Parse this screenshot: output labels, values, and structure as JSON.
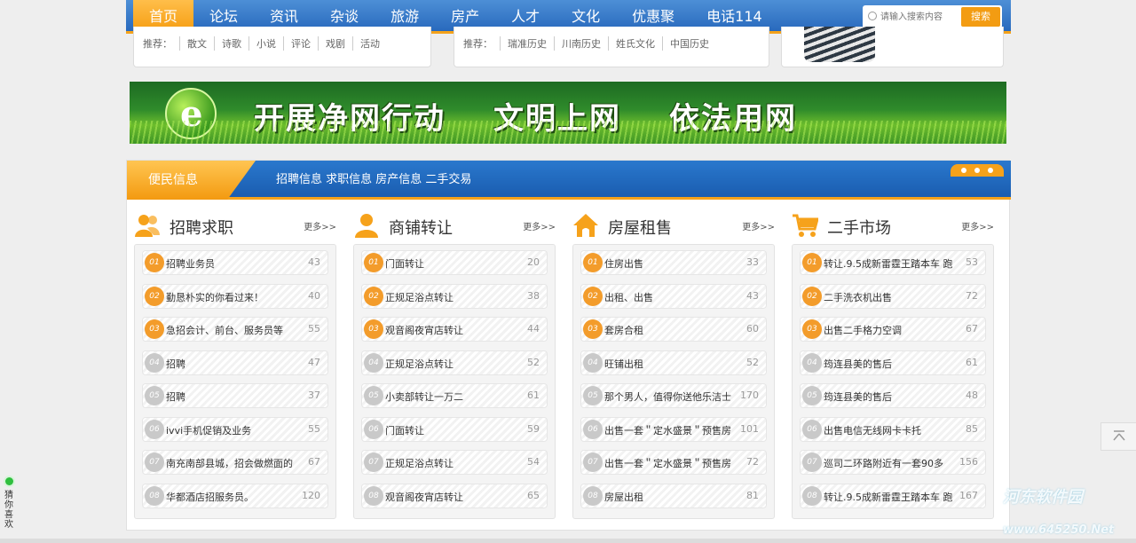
{
  "nav": {
    "items": [
      "首页",
      "论坛",
      "资讯",
      "杂谈",
      "旅游",
      "房产",
      "人才",
      "文化",
      "优惠聚",
      "电话114"
    ],
    "search_placeholder": "请输入搜索内容",
    "search_button": "搜索"
  },
  "top_boxes": [
    {
      "label": "推荐：",
      "tags": [
        "散文",
        "诗歌",
        "小说",
        "评论",
        "戏剧",
        "活动"
      ]
    },
    {
      "label": "推荐：",
      "tags": [
        "瑞准历史",
        "川南历史",
        "姓氏文化",
        "中国历史"
      ]
    }
  ],
  "banner": {
    "parts": [
      "开展净网行动",
      "文明上网",
      "依法用网"
    ]
  },
  "panel": {
    "tab": "便民信息",
    "links": "招聘信息 求职信息 房产信息 二手交易"
  },
  "columns": [
    {
      "title": "招聘求职",
      "more": "更多>>",
      "icon": "people-icon",
      "items": [
        {
          "num": "01",
          "text": "招聘业务员",
          "count": "43"
        },
        {
          "num": "02",
          "text": "勤恳朴实的你看过来！",
          "count": "40"
        },
        {
          "num": "03",
          "text": "急招会计、前台、服务员等",
          "count": "55"
        },
        {
          "num": "04",
          "text": "招聘",
          "count": "47"
        },
        {
          "num": "05",
          "text": "招聘",
          "count": "37"
        },
        {
          "num": "06",
          "text": "ivvi手机促销及业务",
          "count": "55"
        },
        {
          "num": "07",
          "text": "南充南部县城，招会做燃面的",
          "count": "67"
        },
        {
          "num": "08",
          "text": "华都酒店招服务员。",
          "count": "120"
        }
      ]
    },
    {
      "title": "商铺转让",
      "more": "更多>>",
      "icon": "person-icon",
      "items": [
        {
          "num": "01",
          "text": "门面转让",
          "count": "20"
        },
        {
          "num": "02",
          "text": "正规足浴点转让",
          "count": "38"
        },
        {
          "num": "03",
          "text": "观音阁夜宵店转让",
          "count": "44"
        },
        {
          "num": "04",
          "text": "正规足浴点转让",
          "count": "52"
        },
        {
          "num": "05",
          "text": "小卖部转让一万二",
          "count": "61"
        },
        {
          "num": "06",
          "text": "门面转让",
          "count": "59"
        },
        {
          "num": "07",
          "text": "正规足浴点转让",
          "count": "54"
        },
        {
          "num": "08",
          "text": "观音阁夜宵店转让",
          "count": "65"
        }
      ]
    },
    {
      "title": "房屋租售",
      "more": "更多>>",
      "icon": "house-icon",
      "items": [
        {
          "num": "01",
          "text": "住房出售",
          "count": "33"
        },
        {
          "num": "02",
          "text": "出租、出售",
          "count": "43"
        },
        {
          "num": "03",
          "text": "套房合租",
          "count": "60"
        },
        {
          "num": "04",
          "text": "旺铺出租",
          "count": "52"
        },
        {
          "num": "05",
          "text": "那个男人，值得你送他乐洁士",
          "count": "170"
        },
        {
          "num": "06",
          "text": "出售一套＂定水盛景＂预售房",
          "count": "101"
        },
        {
          "num": "07",
          "text": "出售一套＂定水盛景＂预售房",
          "count": "72"
        },
        {
          "num": "08",
          "text": "房屋出租",
          "count": "81"
        }
      ]
    },
    {
      "title": "二手市场",
      "more": "更多>>",
      "icon": "cart-icon",
      "items": [
        {
          "num": "01",
          "text": "转让.9.5成新雷霆王踏本车 跑",
          "count": "53"
        },
        {
          "num": "02",
          "text": "二手洗衣机出售",
          "count": "72"
        },
        {
          "num": "03",
          "text": "出售二手格力空调",
          "count": "67"
        },
        {
          "num": "04",
          "text": "筠连县美的售后",
          "count": "61"
        },
        {
          "num": "05",
          "text": "筠连县美的售后",
          "count": "48"
        },
        {
          "num": "06",
          "text": "出售电信无线网卡卡托",
          "count": "85"
        },
        {
          "num": "07",
          "text": "巡司二环路附近有一套90多",
          "count": "156"
        },
        {
          "num": "08",
          "text": "转让.9.5成新雷霆王踏本车 跑",
          "count": "167"
        }
      ]
    }
  ],
  "side": {
    "guess_text": "猜你喜欢",
    "watermark_brand": "河东软件园",
    "watermark_url": "www.645250.Net"
  },
  "colors": {
    "nav_blue": "#2869bd",
    "accent_orange": "#f39c12",
    "hot_number": "#f39c2b"
  }
}
